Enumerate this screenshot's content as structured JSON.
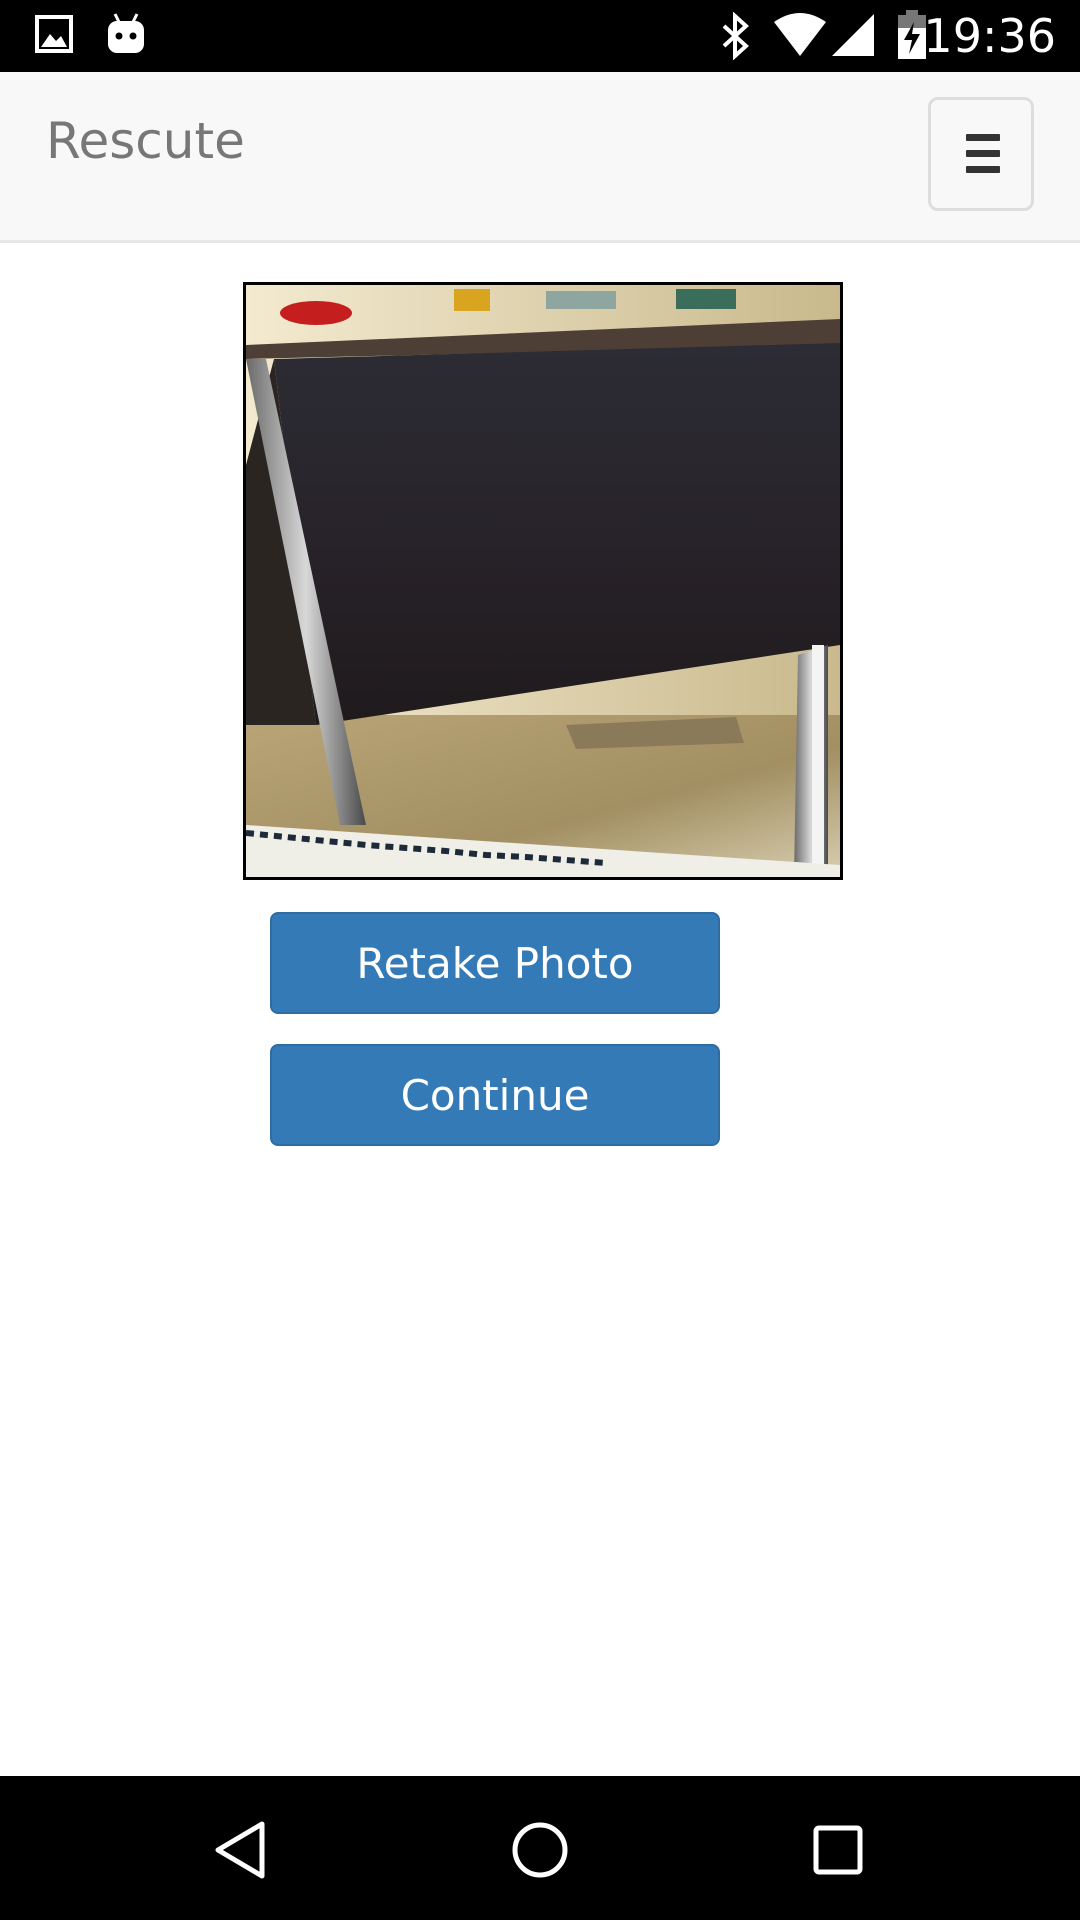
{
  "status_bar": {
    "time": "19:36",
    "icons": [
      "image-notification-icon",
      "android-notification-icon",
      "bluetooth-icon",
      "wifi-icon",
      "cell-signal-icon",
      "battery-charging-icon"
    ]
  },
  "navbar": {
    "brand": "Rescute",
    "menu_icon": "hamburger-menu-icon"
  },
  "photo": {
    "icon": "captured-photo"
  },
  "actions": {
    "retake_label": "Retake Photo",
    "continue_label": "Continue"
  },
  "system_nav": {
    "icons": [
      "back-icon",
      "home-icon",
      "recents-icon"
    ]
  },
  "colors": {
    "button_primary": "#337ab7",
    "navbar_bg": "#f8f8f8",
    "brand_text": "#777777"
  }
}
